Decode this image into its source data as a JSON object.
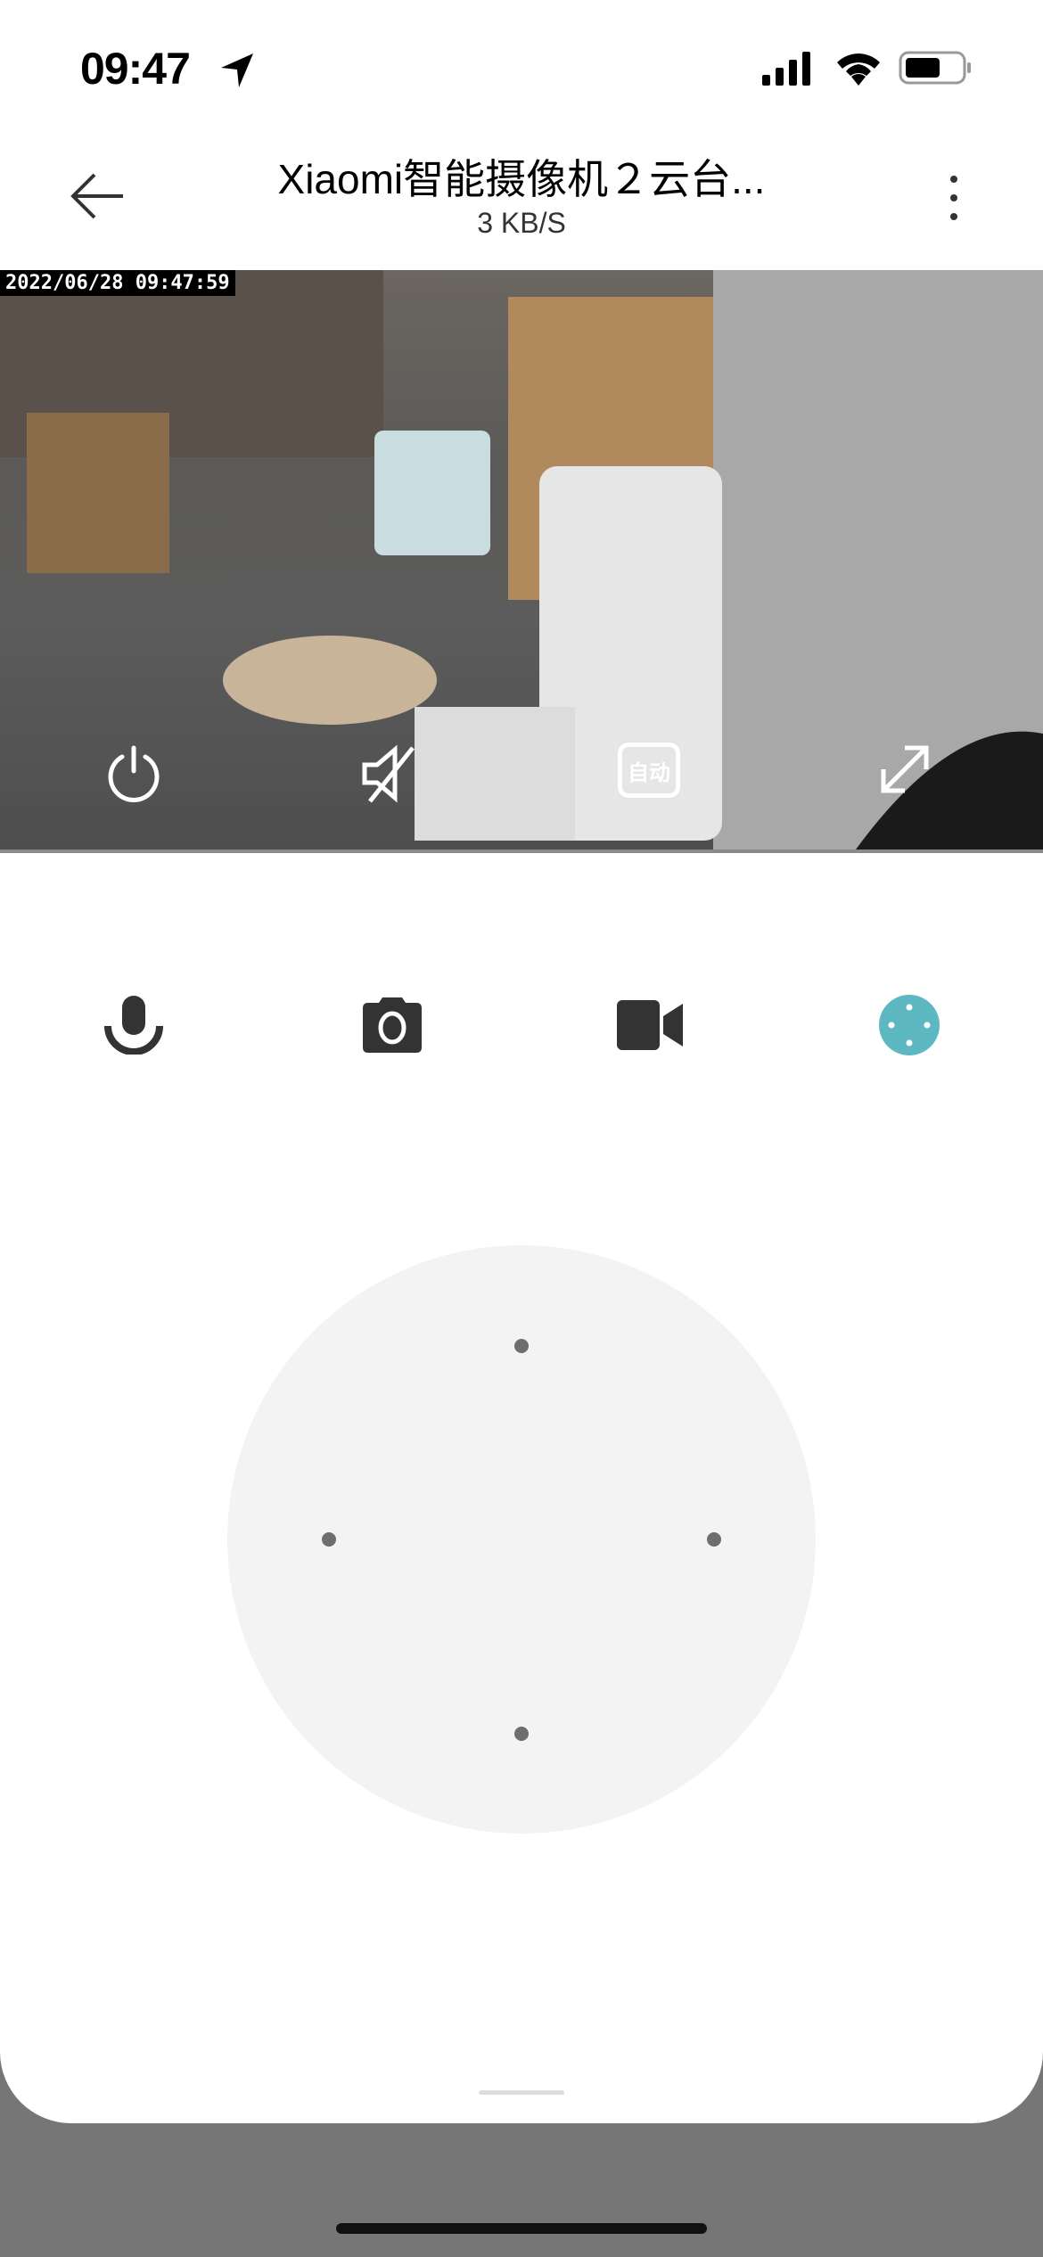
{
  "status_bar": {
    "time": "09:47",
    "icons": [
      "location-arrow-icon",
      "cellular-signal-icon",
      "wifi-icon",
      "battery-icon"
    ]
  },
  "header": {
    "title": "Xiaomi智能摄像机２云台...",
    "subtitle": "3 KB/S",
    "back_icon": "arrow-left-icon",
    "more_icon": "more-vertical-icon"
  },
  "video": {
    "timestamp": "2022/06/28  09:47:59",
    "overlay": {
      "power_icon": "power-icon",
      "mute_icon": "speaker-muted-icon",
      "quality_label": "自动",
      "fullscreen_icon": "expand-icon"
    }
  },
  "toolbar": {
    "items": [
      "microphone-icon",
      "camera-icon",
      "video-record-icon",
      "direction-pad-icon"
    ],
    "active_color": "#5db8c2"
  },
  "ptz": {
    "directions": [
      "up",
      "left",
      "right",
      "down"
    ]
  }
}
